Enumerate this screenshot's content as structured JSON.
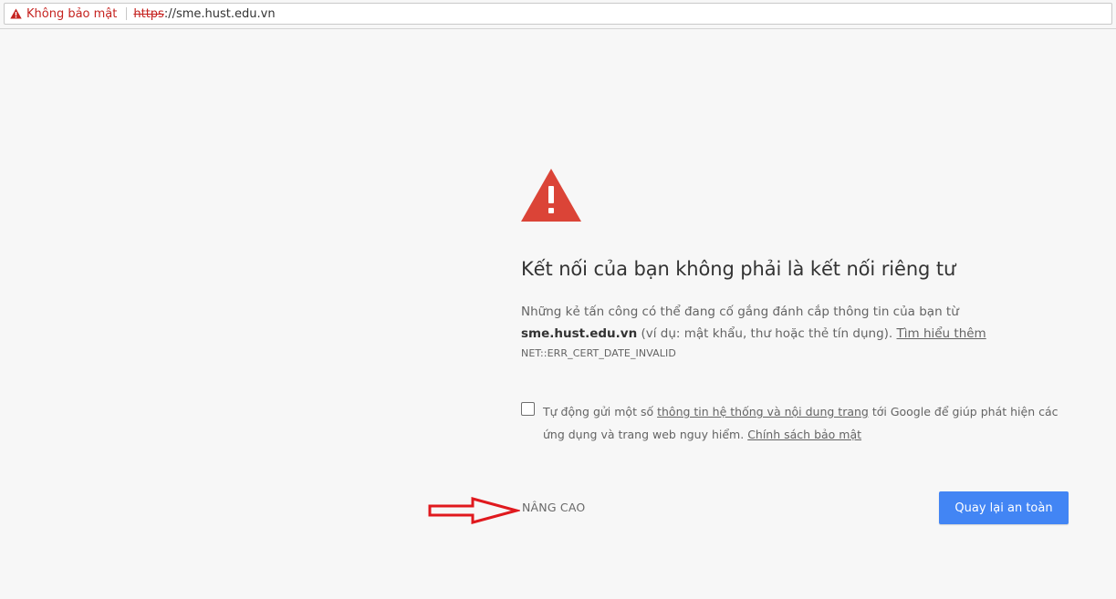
{
  "browser": {
    "security_label": "Không bảo mật",
    "url_scheme": "https",
    "url_rest": "://sme.hust.edu.vn",
    "security_color": "#c5221f"
  },
  "interstitial": {
    "heading": "Kết nối của bạn không phải là kết nối riêng tư",
    "description_part1": "Những kẻ tấn công có thể đang cố gắng đánh cắp thông tin của bạn từ ",
    "domain": "sme.hust.edu.vn",
    "description_part2": " (ví dụ: mật khẩu, thư hoặc thẻ tín dụng). ",
    "learn_more": "Tìm hiểu thêm",
    "error_code": "NET::ERR_CERT_DATE_INVALID",
    "optin_part1": "Tự động gửi một số ",
    "optin_link": "thông tin hệ thống và nội dung trang",
    "optin_part2": " tới Google để giúp phát hiện các ứng dụng và trang web nguy hiểm. ",
    "privacy_link": "Chính sách bảo mật",
    "advanced_label": "NÂNG CAO",
    "back_button_label": "Quay lại an toàn",
    "warning_icon": "warning-triangle-icon",
    "warning_color": "#db4437",
    "button_color": "#4285f4",
    "annotation_arrow_color": "#e0191e"
  }
}
